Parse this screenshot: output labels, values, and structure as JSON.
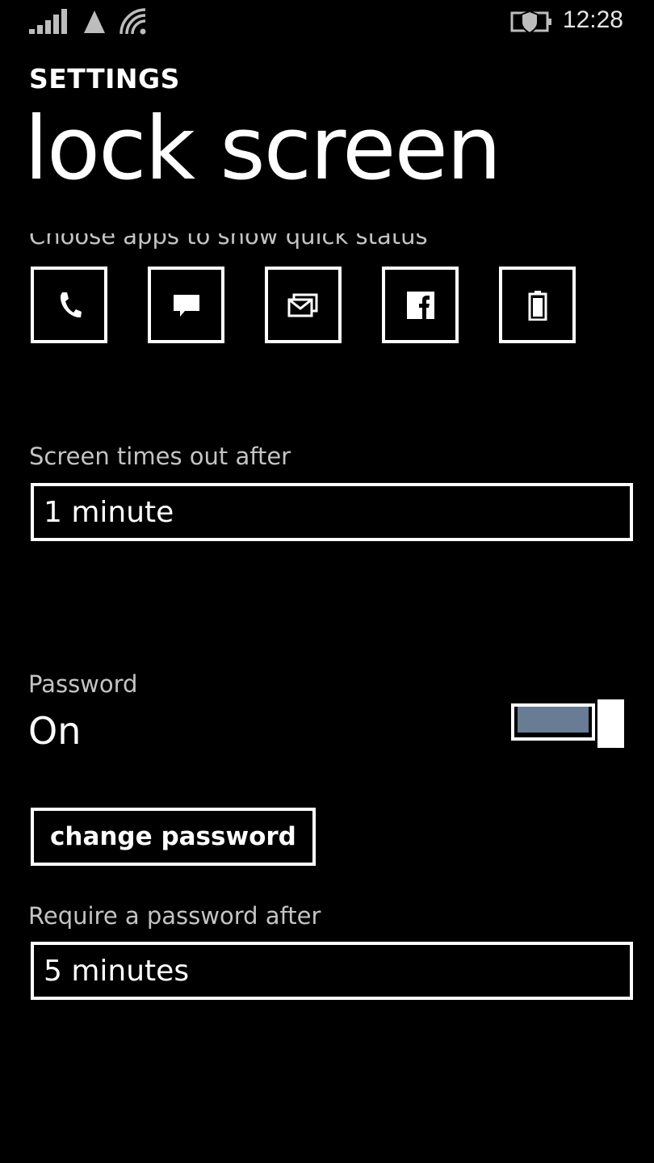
{
  "status_bar": {
    "time": "12:28",
    "icons": [
      "signal-strength-icon",
      "roaming-triangle-icon",
      "wifi-icon",
      "battery-saver-icon"
    ]
  },
  "header": {
    "app_title": "SETTINGS",
    "page_title": "lock screen"
  },
  "quick_status": {
    "label": "Choose apps to show quick status",
    "apps": [
      {
        "icon": "phone-icon"
      },
      {
        "icon": "messaging-icon"
      },
      {
        "icon": "mail-icon"
      },
      {
        "icon": "facebook-icon"
      },
      {
        "icon": "battery-icon"
      }
    ]
  },
  "screen_timeout": {
    "label": "Screen times out after",
    "value": "1 minute"
  },
  "password": {
    "label": "Password",
    "value": "On",
    "enabled": true,
    "toggle_fill_color": "#687d94",
    "change_button_label": "change password"
  },
  "require_password": {
    "label": "Require a password after",
    "value": "5 minutes"
  }
}
